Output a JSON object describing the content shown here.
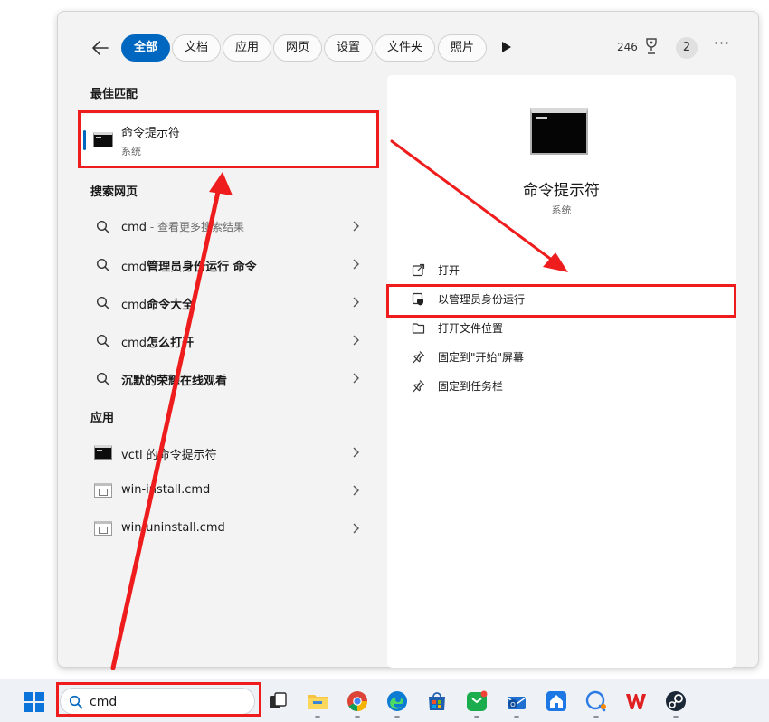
{
  "header": {
    "tabs": [
      {
        "label": "全部",
        "active": true
      },
      {
        "label": "文档",
        "active": false
      },
      {
        "label": "应用",
        "active": false
      },
      {
        "label": "网页",
        "active": false
      },
      {
        "label": "设置",
        "active": false
      },
      {
        "label": "文件夹",
        "active": false
      },
      {
        "label": "照片",
        "active": false
      }
    ],
    "points": "246",
    "notification_count": "2",
    "more_label": "···"
  },
  "best_match": {
    "section_label": "最佳匹配",
    "title": "命令提示符",
    "subtitle": "系统"
  },
  "web": {
    "section_label": "搜索网页",
    "items": [
      {
        "prefix": "cmd",
        "bold": "",
        "hint": " - 查看更多搜索结果"
      },
      {
        "prefix": "cmd",
        "bold": "管理员身份运行 命令",
        "hint": ""
      },
      {
        "prefix": "cmd",
        "bold": "命令大全",
        "hint": ""
      },
      {
        "prefix": "cmd",
        "bold": "怎么打开",
        "hint": ""
      },
      {
        "prefix": "",
        "bold": "沉默的荣耀在线观看",
        "hint": ""
      }
    ]
  },
  "apps": {
    "section_label": "应用",
    "items": [
      {
        "label": "vctl 的命令提示符",
        "icon": "cmd-icon"
      },
      {
        "label": "win-install.cmd",
        "icon": "cmd-file-icon"
      },
      {
        "label": "win-uninstall.cmd",
        "icon": "cmd-file-icon"
      }
    ]
  },
  "detail": {
    "title": "命令提示符",
    "subtitle": "系统",
    "actions": [
      {
        "label": "打开",
        "icon": "open-external-icon"
      },
      {
        "label": "以管理员身份运行",
        "icon": "shield-icon"
      },
      {
        "label": "打开文件位置",
        "icon": "folder-icon"
      },
      {
        "label": "固定到\"开始\"屏幕",
        "icon": "pin-icon"
      },
      {
        "label": "固定到任务栏",
        "icon": "pin-icon"
      }
    ]
  },
  "taskbar": {
    "search_value": "cmd",
    "apps": [
      "task-view-icon",
      "file-explorer-icon",
      "chrome-icon",
      "edge-icon",
      "store-icon",
      "wechat-icon",
      "mail-icon",
      "app-icon",
      "chat-icon",
      "wps-icon",
      "steam-icon"
    ]
  },
  "colors": {
    "accent": "#0067c0",
    "annotation": "#ee1c1c",
    "panel_bg": "#f3f3f3",
    "taskbar_bg": "#eef1f6"
  }
}
